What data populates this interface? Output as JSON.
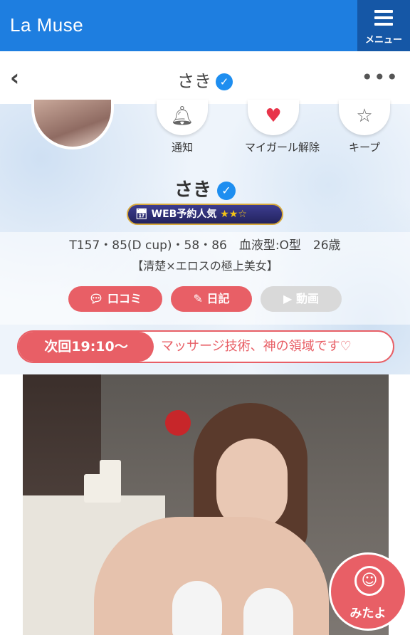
{
  "header": {
    "brand": "La Muse",
    "menu_label": "メニュー"
  },
  "nav": {
    "back_icon": "‹",
    "title": "さき",
    "more_icon": "•••"
  },
  "profile": {
    "actions": [
      {
        "label": "通知",
        "icon": "bell-icon"
      },
      {
        "label": "マイガール解除",
        "icon": "heart-icon"
      },
      {
        "label": "キープ",
        "icon": "star-icon"
      }
    ],
    "name": "さき",
    "badge_text": "WEB予約人気",
    "badge_stars": "★★☆",
    "stats": "T157・85(D cup)・58・86　血液型:O型　26歳",
    "catchphrase": "【清楚×エロスの極上美女】",
    "buttons": {
      "reviews": "口コミ",
      "diary": "日記",
      "video": "動画"
    }
  },
  "next_time": {
    "label": "次回19:10〜",
    "message": "マッサージ技術、神の領域です♡"
  },
  "floating": {
    "mitayo_label": "みたよ"
  },
  "colors": {
    "header_blue": "#1e7ee0",
    "menu_blue": "#1557a6",
    "accent_pink": "#e85f66",
    "verified_blue": "#1e8ef0"
  }
}
